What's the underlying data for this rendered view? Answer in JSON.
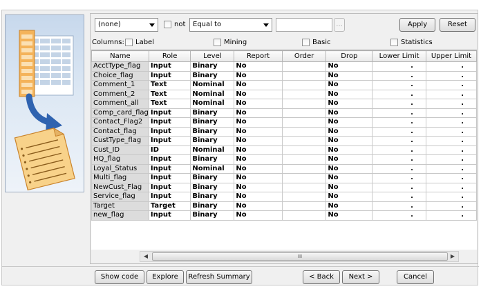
{
  "titlebar": {
    "text": ""
  },
  "filter": {
    "column_select": "(none)",
    "not_label": "not",
    "operator_select": "Equal to",
    "value": "",
    "browse_label": "...",
    "apply_label": "Apply",
    "reset_label": "Reset"
  },
  "columns": {
    "label": "Columns:",
    "options": [
      "Label",
      "Mining",
      "Basic",
      "Statistics"
    ]
  },
  "table": {
    "headers": [
      "Name",
      "Role",
      "Level",
      "Report",
      "Order",
      "Drop",
      "Lower Limit",
      "Upper Limit"
    ],
    "rows": [
      [
        "AcctType_flag",
        "Input",
        "Binary",
        "No",
        "",
        "No",
        ".",
        "."
      ],
      [
        "Choice_flag",
        "Input",
        "Binary",
        "No",
        "",
        "No",
        ".",
        "."
      ],
      [
        "Comment_1",
        "Text",
        "Nominal",
        "No",
        "",
        "No",
        ".",
        "."
      ],
      [
        "Comment_2",
        "Text",
        "Nominal",
        "No",
        "",
        "No",
        ".",
        "."
      ],
      [
        "Comment_all",
        "Text",
        "Nominal",
        "No",
        "",
        "No",
        ".",
        "."
      ],
      [
        "Comp_card_flag",
        "Input",
        "Binary",
        "No",
        "",
        "No",
        ".",
        "."
      ],
      [
        "Contact_Flag2",
        "Input",
        "Binary",
        "No",
        "",
        "No",
        ".",
        "."
      ],
      [
        "Contact_flag",
        "Input",
        "Binary",
        "No",
        "",
        "No",
        ".",
        "."
      ],
      [
        "CustType_flag",
        "Input",
        "Binary",
        "No",
        "",
        "No",
        ".",
        "."
      ],
      [
        "Cust_ID",
        "ID",
        "Nominal",
        "No",
        "",
        "No",
        ".",
        "."
      ],
      [
        "HQ_flag",
        "Input",
        "Binary",
        "No",
        "",
        "No",
        ".",
        "."
      ],
      [
        "Loyal_Status",
        "Input",
        "Nominal",
        "No",
        "",
        "No",
        ".",
        "."
      ],
      [
        "Multi_flag",
        "Input",
        "Binary",
        "No",
        "",
        "No",
        ".",
        "."
      ],
      [
        "NewCust_Flag",
        "Input",
        "Binary",
        "No",
        "",
        "No",
        ".",
        "."
      ],
      [
        "Service_flag",
        "Input",
        "Binary",
        "No",
        "",
        "No",
        ".",
        "."
      ],
      [
        "Target",
        "Target",
        "Binary",
        "No",
        "",
        "No",
        ".",
        "."
      ],
      [
        "new_flag",
        "Input",
        "Binary",
        "No",
        "",
        "No",
        ".",
        "."
      ]
    ]
  },
  "scrollbar": {
    "grip": "III"
  },
  "footer": {
    "show_code": "Show code",
    "explore": "Explore",
    "refresh_summary": "Refresh Summary",
    "back": "< Back",
    "next": "Next >",
    "cancel": "Cancel"
  },
  "colors": {
    "accent": "#3f6fb5",
    "panel_bg": "#c7d8ec",
    "name_cell": "#dcdcdc"
  }
}
